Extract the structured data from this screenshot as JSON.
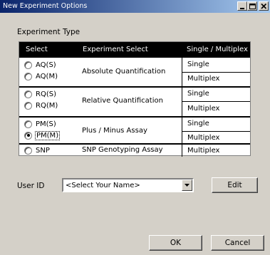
{
  "window": {
    "title": "New Experiment Options"
  },
  "title_buttons": {
    "minimize_icon": "minimize-icon",
    "maximize_icon": "maximize-icon",
    "close_icon": "close-icon"
  },
  "experiment_type": {
    "label": "Experiment Type",
    "headers": {
      "select": "Select",
      "experiment_select": "Experiment Select",
      "mode": "Single / Multiplex"
    },
    "groups": [
      {
        "name": "Absolute Quantification",
        "options": [
          {
            "label": "AQ(S)",
            "checked": false
          },
          {
            "label": "AQ(M)",
            "checked": false
          }
        ],
        "modes": [
          "Single",
          "Multiplex"
        ]
      },
      {
        "name": "Relative Quantification",
        "options": [
          {
            "label": "RQ(S)",
            "checked": false
          },
          {
            "label": "RQ(M)",
            "checked": false
          }
        ],
        "modes": [
          "Single",
          "Multiplex"
        ]
      },
      {
        "name": "Plus / Minus Assay",
        "options": [
          {
            "label": "PM(S)",
            "checked": false
          },
          {
            "label": "PM(M)",
            "checked": true
          }
        ],
        "modes": [
          "Single",
          "Multiplex"
        ]
      },
      {
        "name": "SNP Genotyping Assay",
        "options": [
          {
            "label": "SNP",
            "checked": false
          }
        ],
        "modes": [
          "Multiplex"
        ]
      }
    ]
  },
  "user": {
    "label": "User ID",
    "selected": "<Select Your Name>",
    "edit_label": "Edit"
  },
  "footer": {
    "ok_label": "OK",
    "cancel_label": "Cancel"
  },
  "colors": {
    "titlebar_start": "#0a246a",
    "titlebar_end": "#a6caf0",
    "dialog_bg": "#d4d0c8",
    "table_header_bg": "#000000"
  }
}
